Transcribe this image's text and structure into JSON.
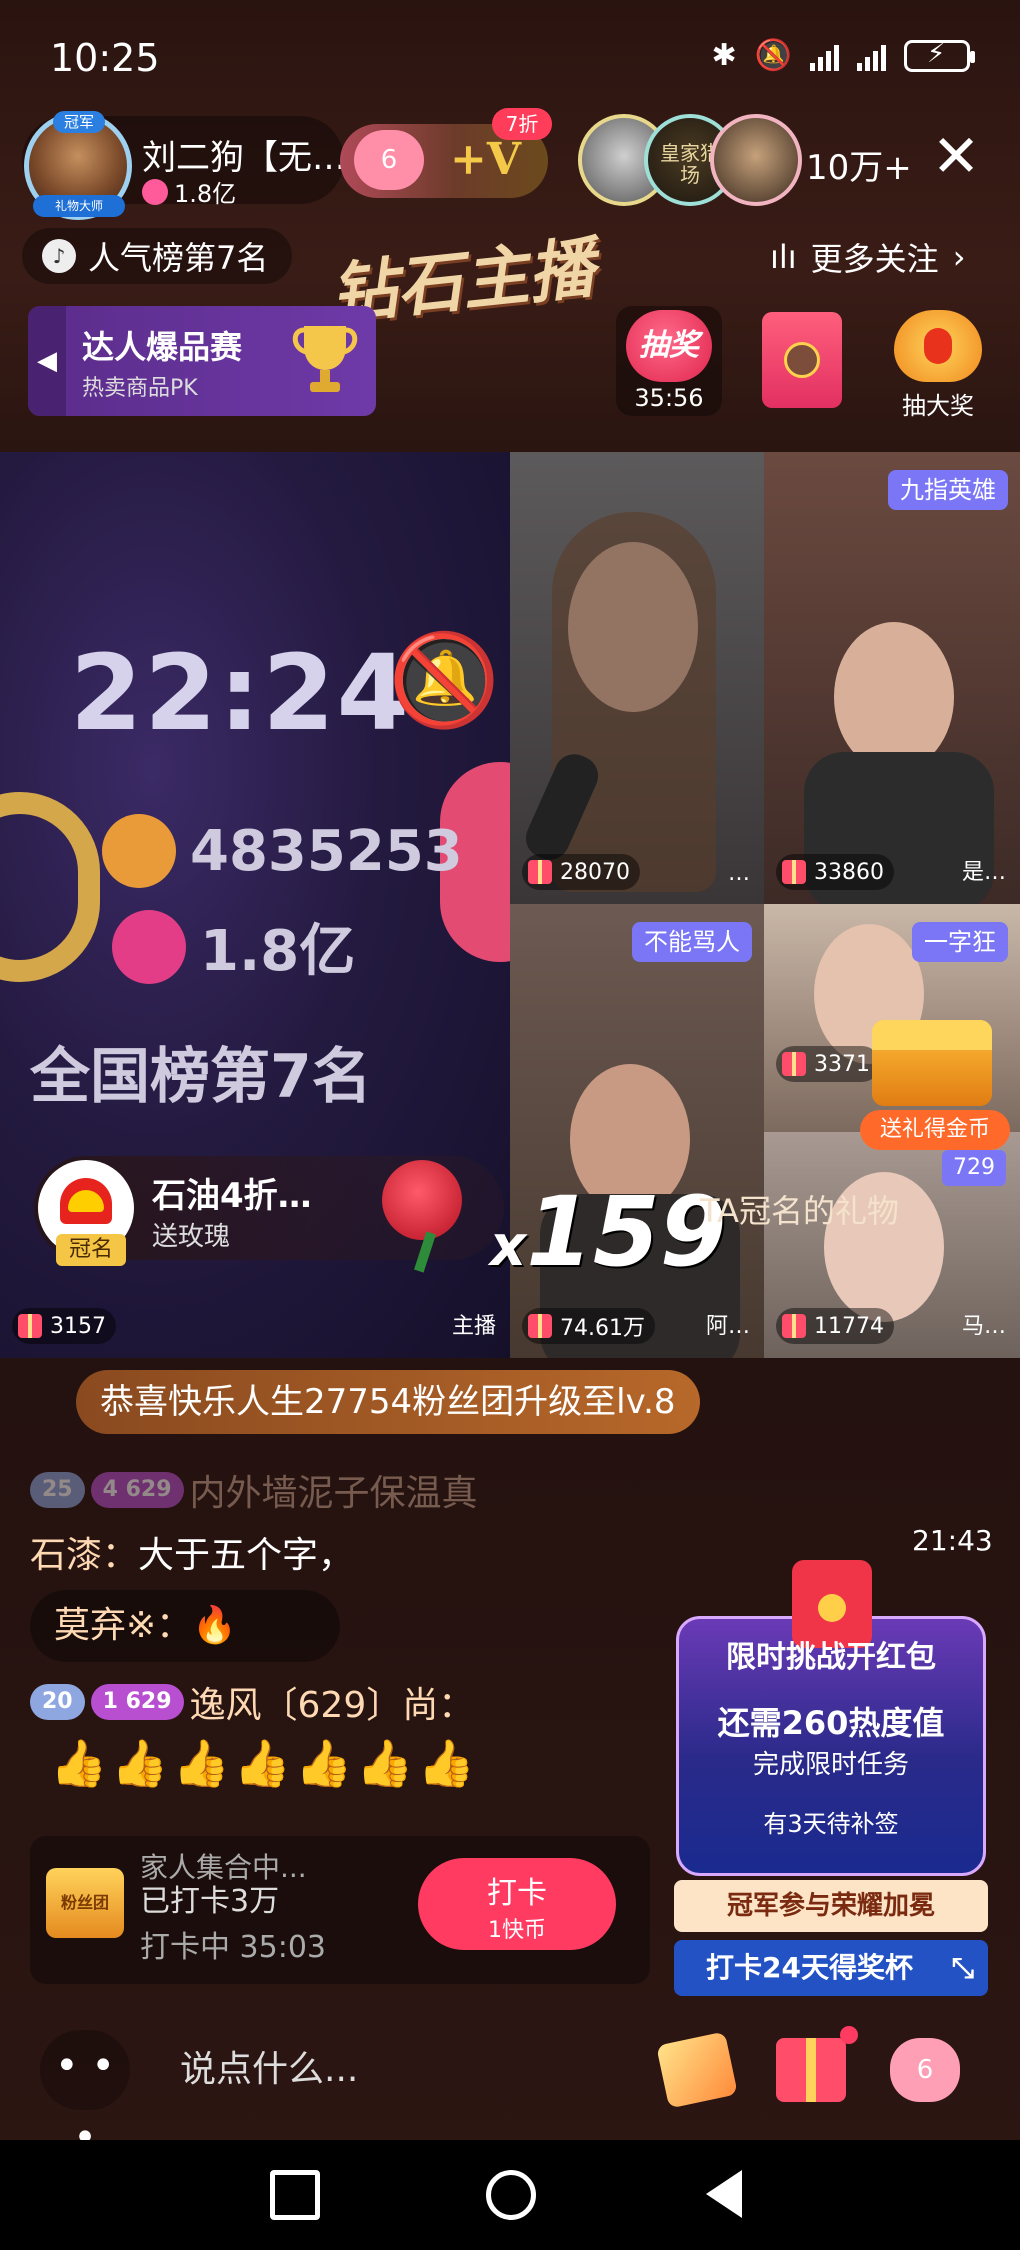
{
  "status_bar": {
    "time": "10:25"
  },
  "header": {
    "host_avatar_tag": "冠军",
    "host_avatar_ribbon": "礼物大师",
    "host_name": "刘二狗【无…",
    "host_likes": "1.8亿",
    "fan_level": "6",
    "discount_badge": "7折",
    "vip_label": "+V",
    "viewer2_label": "皇家猎场",
    "viewer_count": "10万+",
    "close_symbol": "✕"
  },
  "subheader": {
    "rank_text": "人气榜第7名",
    "title_banner": "钻石主播",
    "more_follow": "更多关注"
  },
  "promo": {
    "title": "达人爆品赛",
    "subtitle": "热卖商品PK"
  },
  "widgets": {
    "lottery_label": "抽奖",
    "lottery_timer": "35:56",
    "big_prize_label": "抽大奖"
  },
  "main_video": {
    "clock": "22:24",
    "fans": "4835253",
    "likes": "1.8亿",
    "rank": "全国榜第7名",
    "gift_count": "3157",
    "role_label": "主播"
  },
  "tiles": [
    {
      "gift_count": "28070",
      "name": "…"
    },
    {
      "tag": "九指英雄",
      "gift_count": "33860",
      "name": "是…"
    },
    {
      "tag": "不能骂人",
      "gift_count": "74.61万",
      "name": "阿…"
    },
    {
      "tag": "一字狂",
      "gift_count": "3371"
    },
    {
      "gift_count": "11774",
      "name": "马…"
    }
  ],
  "gift_popup": {
    "sender": "石油4折…",
    "action": "送玫瑰",
    "badge": "冠名",
    "combo_x": "x",
    "combo_count": "159",
    "ta_gift": "TA冠名的礼物",
    "tile_number": "729",
    "coin_tag": "送礼得金币"
  },
  "chat": {
    "congrats": "恭喜快乐人生27754粉丝团升级至lv.8",
    "line1_level": "25",
    "line1_fan": "4 629",
    "line1_text": "内外墙泥子保温真",
    "line2_user": "石漆：",
    "line2_text": "大于五个字，",
    "line3_text": "莫弃※：🔥",
    "line4_level": "20",
    "line4_fan": "1 629",
    "line4_text": "逸风〔629〕尚：",
    "thumbs": "👍👍👍👍👍👍👍",
    "timestamp": "21:43"
  },
  "checkin": {
    "icon_label": "粉丝团",
    "line1": "家人集合中...",
    "line2": "已打卡3万",
    "line3": "打卡中 35:03",
    "button_title": "打卡",
    "button_sub": "1快币"
  },
  "challenge": {
    "title": "限时挑战开红包",
    "needed": "还需260热度值",
    "task": "完成限时任务",
    "extra": "有3天待补签",
    "honor": "冠军参与荣耀加冕",
    "cup": "打卡24天得奖杯"
  },
  "bottom_bar": {
    "more": "• • •",
    "input_placeholder": "说点什么...",
    "fan_level": "6"
  }
}
